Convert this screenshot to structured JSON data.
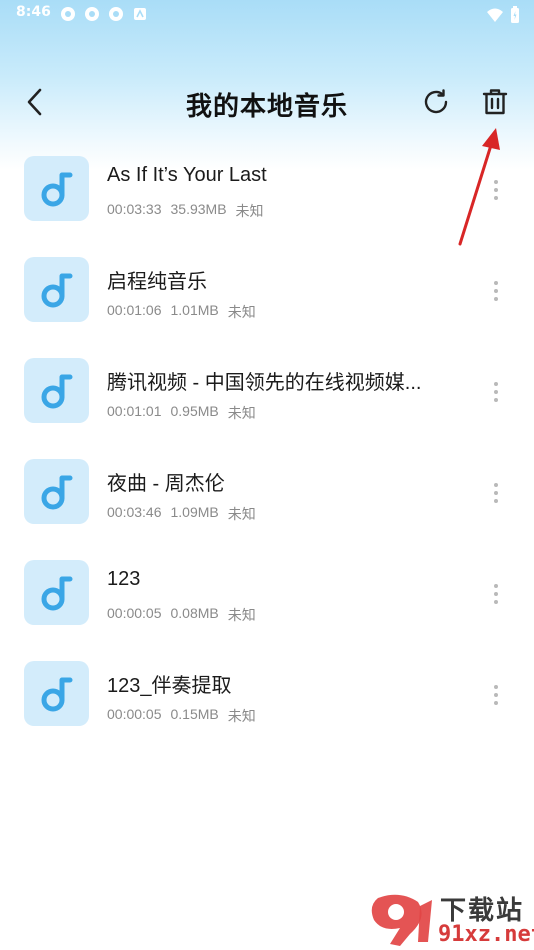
{
  "status_bar": {
    "time": "8:46"
  },
  "header": {
    "title": "我的本地音乐"
  },
  "songs": [
    {
      "title": "As If It’s Your Last",
      "duration": "00:03:33",
      "size": "35.93MB",
      "artist": "未知"
    },
    {
      "title": "启程纯音乐",
      "duration": "00:01:06",
      "size": "1.01MB",
      "artist": "未知"
    },
    {
      "title": "腾讯视频 - 中国领先的在线视频媒...",
      "duration": "00:01:01",
      "size": "0.95MB",
      "artist": "未知"
    },
    {
      "title": "夜曲 - 周杰伦",
      "duration": "00:03:46",
      "size": "1.09MB",
      "artist": "未知"
    },
    {
      "title": "123",
      "duration": "00:00:05",
      "size": "0.08MB",
      "artist": "未知"
    },
    {
      "title": "123_伴奏提取",
      "duration": "00:00:05",
      "size": "0.15MB",
      "artist": "未知"
    }
  ],
  "watermark": {
    "line1": "下载站",
    "line2": "91xz.net"
  },
  "colors": {
    "accent": "#3aa6e6",
    "thumb_bg": "#d3ecfb",
    "arrow": "#d82626"
  }
}
